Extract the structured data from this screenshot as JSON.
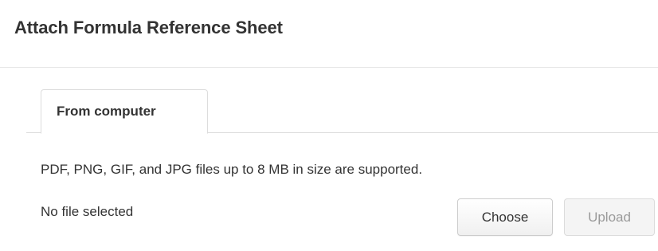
{
  "dialog": {
    "title": "Attach Formula Reference Sheet"
  },
  "tabs": [
    {
      "label": "From computer",
      "active": true
    }
  ],
  "upload": {
    "info_text": "PDF, PNG, GIF, and JPG files up to 8 MB in size are supported.",
    "file_status": "No file selected",
    "choose_label": "Choose",
    "upload_label": "Upload",
    "upload_disabled": true
  },
  "colors": {
    "text": "#333333",
    "border": "#dddddd",
    "disabled_text": "#9a9a9a"
  }
}
